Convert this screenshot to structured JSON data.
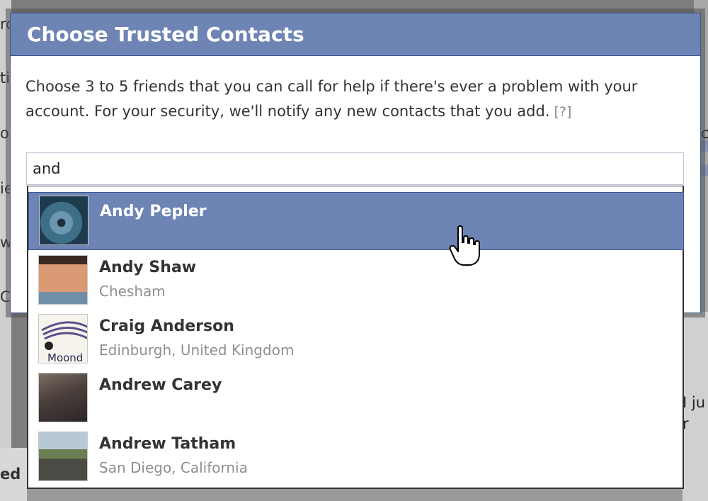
{
  "background": {
    "left_fragments": [
      "rc",
      "ti",
      "o",
      "ie",
      "w",
      "Co"
    ],
    "right_fragments": [
      "c",
      "I ju",
      "r"
    ],
    "bottom_left_text": "ed"
  },
  "dialog": {
    "title": "Choose Trusted Contacts",
    "description": "Choose 3 to 5 friends that you can call for help if there's ever a problem with your account. For your security, we'll notify any new contacts that you add.",
    "help_link": "[?]",
    "search": {
      "value": "and",
      "placeholder": ""
    }
  },
  "suggestions": [
    {
      "name": "Andy Pepler",
      "location": "",
      "selected": true,
      "avatar_icon": "avatar-photo"
    },
    {
      "name": "Andy Shaw",
      "location": "Chesham",
      "selected": false,
      "avatar_icon": "avatar-photo"
    },
    {
      "name": "Craig Anderson",
      "location": "Edinburgh, United Kingdom",
      "selected": false,
      "avatar_icon": "avatar-logo",
      "avatar_text": "Moond"
    },
    {
      "name": "Andrew Carey",
      "location": "",
      "selected": false,
      "avatar_icon": "avatar-photo"
    },
    {
      "name": "Andrew Tatham",
      "location": "San Diego, California",
      "selected": false,
      "avatar_icon": "avatar-photo"
    }
  ],
  "colors": {
    "header_blue": "#6d84b4",
    "border_blue": "#3b5998",
    "selected_row": "#6d84b4"
  },
  "cursor_icon": "hand-pointer-icon"
}
